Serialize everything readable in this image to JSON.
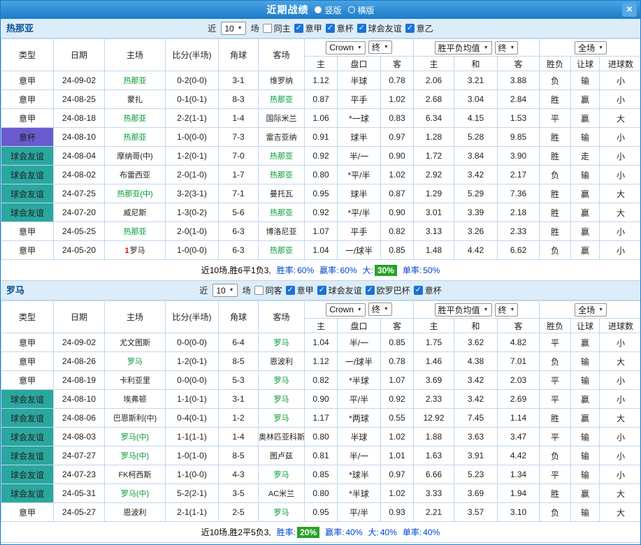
{
  "colors": {
    "accent_blue": "#1c7cc8",
    "section_bg": "#dcedf9",
    "table_border": "#bdd8ef",
    "win_red": "#e60000",
    "lose_green": "#009933",
    "odds_blue": "#0055cc",
    "coppa_purple": "#6a5bd0",
    "friendly_teal": "#2aa79e",
    "highlight_green": "#28a228"
  },
  "titlebar": {
    "title": "近期战绩",
    "layout_options": [
      {
        "label": "竖版",
        "selected": true
      },
      {
        "label": "横版",
        "selected": false
      }
    ],
    "close_label": "×"
  },
  "columns": {
    "type": "类型",
    "date": "日期",
    "home": "主场",
    "score": "比分(半场)",
    "corner": "角球",
    "away": "客场",
    "host": "主",
    "handicap": "盘口",
    "guest": "客",
    "avg_home": "主",
    "avg_draw": "和",
    "avg_away": "客",
    "result": "胜负",
    "handicap_result": "让球",
    "goals": "进球数"
  },
  "selectors": {
    "odds_source": "Crown",
    "odds_final": "终",
    "avg_method": "胜平负均值",
    "avg_final": "终",
    "scope": "全场"
  },
  "sections": [
    {
      "team": "热那亚",
      "filters": {
        "recent_label": "近",
        "count": "10",
        "unit_label": "场",
        "venue_filter": {
          "label": "同主",
          "checked": false
        },
        "competitions": [
          {
            "label": "意甲",
            "checked": true
          },
          {
            "label": "意杯",
            "checked": true
          },
          {
            "label": "球会友谊",
            "checked": true
          },
          {
            "label": "意乙",
            "checked": true
          }
        ]
      },
      "rows": [
        {
          "type": "意甲",
          "date": "24-09-02",
          "home": "热那亚",
          "rank": "",
          "score": "0-2(0-0)",
          "corners": "3-1",
          "away": "维罗纳",
          "odds_home": "1.12",
          "handicap": "半球",
          "odds_away": "0.78",
          "avg_home": "2.06",
          "avg_draw": "3.21",
          "avg_away": "3.88",
          "result": "负",
          "handicap_result": "输",
          "goals": "小"
        },
        {
          "type": "意甲",
          "date": "24-08-25",
          "home": "蒙扎",
          "rank": "",
          "score": "0-1(0-1)",
          "corners": "8-3",
          "away": "热那亚",
          "odds_home": "0.87",
          "handicap": "平手",
          "odds_away": "1.02",
          "avg_home": "2.68",
          "avg_draw": "3.04",
          "avg_away": "2.84",
          "result": "胜",
          "handicap_result": "赢",
          "goals": "小"
        },
        {
          "type": "意甲",
          "date": "24-08-18",
          "home": "热那亚",
          "rank": "",
          "score": "2-2(1-1)",
          "corners": "1-4",
          "away": "国际米兰",
          "odds_home": "1.06",
          "handicap": "*一球",
          "odds_away": "0.83",
          "avg_home": "6.34",
          "avg_draw": "4.15",
          "avg_away": "1.53",
          "result": "平",
          "handicap_result": "赢",
          "goals": "大"
        },
        {
          "type": "意杯",
          "date": "24-08-10",
          "home": "热那亚",
          "rank": "",
          "score": "1-0(0-0)",
          "corners": "7-3",
          "away": "雷吉亚纳",
          "odds_home": "0.91",
          "handicap": "球半",
          "odds_away": "0.97",
          "avg_home": "1.28",
          "avg_draw": "5.28",
          "avg_away": "9.85",
          "result": "胜",
          "handicap_result": "输",
          "goals": "小"
        },
        {
          "type": "球会友谊",
          "date": "24-08-04",
          "home": "摩纳哥(中)",
          "rank": "",
          "score": "1-2(0-1)",
          "corners": "7-0",
          "away": "热那亚",
          "odds_home": "0.92",
          "handicap": "半/一",
          "odds_away": "0.90",
          "avg_home": "1.72",
          "avg_draw": "3.84",
          "avg_away": "3.90",
          "result": "胜",
          "handicap_result": "走",
          "goals": "小"
        },
        {
          "type": "球会友谊",
          "date": "24-08-02",
          "home": "布雷西亚",
          "rank": "",
          "score": "2-0(1-0)",
          "corners": "1-7",
          "away": "热那亚",
          "odds_home": "0.80",
          "handicap": "*平/半",
          "odds_away": "1.02",
          "avg_home": "2.92",
          "avg_draw": "3.42",
          "avg_away": "2.17",
          "result": "负",
          "handicap_result": "输",
          "goals": "小"
        },
        {
          "type": "球会友谊",
          "date": "24-07-25",
          "home": "热那亚(中)",
          "rank": "",
          "score": "3-2(3-1)",
          "corners": "7-1",
          "away": "曼托瓦",
          "odds_home": "0.95",
          "handicap": "球半",
          "odds_away": "0.87",
          "avg_home": "1.29",
          "avg_draw": "5.29",
          "avg_away": "7.36",
          "result": "胜",
          "handicap_result": "赢",
          "goals": "大"
        },
        {
          "type": "球会友谊",
          "date": "24-07-20",
          "home": "威尼斯",
          "rank": "",
          "score": "1-3(0-2)",
          "corners": "5-6",
          "away": "热那亚",
          "odds_home": "0.92",
          "handicap": "*平/半",
          "odds_away": "0.90",
          "avg_home": "3.01",
          "avg_draw": "3.39",
          "avg_away": "2.18",
          "result": "胜",
          "handicap_result": "赢",
          "goals": "大"
        },
        {
          "type": "意甲",
          "date": "24-05-25",
          "home": "热那亚",
          "rank": "",
          "score": "2-0(1-0)",
          "corners": "6-3",
          "away": "博洛尼亚",
          "odds_home": "1.07",
          "handicap": "平手",
          "odds_away": "0.82",
          "avg_home": "3.13",
          "avg_draw": "3.26",
          "avg_away": "2.33",
          "result": "胜",
          "handicap_result": "赢",
          "goals": "小"
        },
        {
          "type": "意甲",
          "date": "24-05-20",
          "home": "罗马",
          "rank": "1",
          "score": "1-0(0-0)",
          "corners": "6-3",
          "away": "热那亚",
          "odds_home": "1.04",
          "handicap": "一/球半",
          "odds_away": "0.85",
          "avg_home": "1.48",
          "avg_draw": "4.42",
          "avg_away": "6.62",
          "result": "负",
          "handicap_result": "赢",
          "goals": "小"
        }
      ],
      "footer": {
        "summary": "近10场,胜6平1负3,",
        "stats": [
          {
            "label": "胜率:",
            "value": "60%",
            "highlight": false
          },
          {
            "label": "赢率:",
            "value": "60%",
            "highlight": false
          },
          {
            "label": "大:",
            "value": "30%",
            "highlight": true
          },
          {
            "label": "单率:",
            "value": "50%",
            "highlight": false
          }
        ]
      }
    },
    {
      "team": "罗马",
      "filters": {
        "recent_label": "近",
        "count": "10",
        "unit_label": "场",
        "venue_filter": {
          "label": "同客",
          "checked": false
        },
        "competitions": [
          {
            "label": "意甲",
            "checked": true
          },
          {
            "label": "球会友谊",
            "checked": true
          },
          {
            "label": "欧罗巴杯",
            "checked": true
          },
          {
            "label": "意杯",
            "checked": true
          }
        ]
      },
      "rows": [
        {
          "type": "意甲",
          "date": "24-09-02",
          "home": "尤文图斯",
          "rank": "",
          "score": "0-0(0-0)",
          "corners": "6-4",
          "away": "罗马",
          "odds_home": "1.04",
          "handicap": "半/一",
          "odds_away": "0.85",
          "avg_home": "1.75",
          "avg_draw": "3.62",
          "avg_away": "4.82",
          "result": "平",
          "handicap_result": "赢",
          "goals": "小"
        },
        {
          "type": "意甲",
          "date": "24-08-26",
          "home": "罗马",
          "rank": "",
          "score": "1-2(0-1)",
          "corners": "8-5",
          "away": "恩波利",
          "odds_home": "1.12",
          "handicap": "一/球半",
          "odds_away": "0.78",
          "avg_home": "1.46",
          "avg_draw": "4.38",
          "avg_away": "7.01",
          "result": "负",
          "handicap_result": "输",
          "goals": "大"
        },
        {
          "type": "意甲",
          "date": "24-08-19",
          "home": "卡利亚里",
          "rank": "",
          "score": "0-0(0-0)",
          "corners": "5-3",
          "away": "罗马",
          "odds_home": "0.82",
          "handicap": "*半球",
          "odds_away": "1.07",
          "avg_home": "3.69",
          "avg_draw": "3.42",
          "avg_away": "2.03",
          "result": "平",
          "handicap_result": "输",
          "goals": "小"
        },
        {
          "type": "球会友谊",
          "date": "24-08-10",
          "home": "埃弗顿",
          "rank": "",
          "score": "1-1(0-1)",
          "corners": "3-1",
          "away": "罗马",
          "odds_home": "0.90",
          "handicap": "平/半",
          "odds_away": "0.92",
          "avg_home": "2.33",
          "avg_draw": "3.42",
          "avg_away": "2.69",
          "result": "平",
          "handicap_result": "赢",
          "goals": "小"
        },
        {
          "type": "球会友谊",
          "date": "24-08-06",
          "home": "巴恩斯利(中)",
          "rank": "",
          "score": "0-4(0-1)",
          "corners": "1-2",
          "away": "罗马",
          "odds_home": "1.17",
          "handicap": "*两球",
          "odds_away": "0.55",
          "avg_home": "12.92",
          "avg_draw": "7.45",
          "avg_away": "1.14",
          "result": "胜",
          "handicap_result": "赢",
          "goals": "大"
        },
        {
          "type": "球会友谊",
          "date": "24-08-03",
          "home": "罗马(中)",
          "rank": "",
          "score": "1-1(1-1)",
          "corners": "1-4",
          "away": "奥林匹亚科斯",
          "odds_home": "0.80",
          "handicap": "半球",
          "odds_away": "1.02",
          "avg_home": "1.88",
          "avg_draw": "3.63",
          "avg_away": "3.47",
          "result": "平",
          "handicap_result": "输",
          "goals": "小"
        },
        {
          "type": "球会友谊",
          "date": "24-07-27",
          "home": "罗马(中)",
          "rank": "",
          "score": "1-0(1-0)",
          "corners": "8-5",
          "away": "图卢兹",
          "odds_home": "0.81",
          "handicap": "半/一",
          "odds_away": "1.01",
          "avg_home": "1.63",
          "avg_draw": "3.91",
          "avg_away": "4.42",
          "result": "负",
          "handicap_result": "输",
          "goals": "小"
        },
        {
          "type": "球会友谊",
          "date": "24-07-23",
          "home": "FK柯西斯",
          "rank": "",
          "score": "1-1(0-0)",
          "corners": "4-3",
          "away": "罗马",
          "odds_home": "0.85",
          "handicap": "*球半",
          "odds_away": "0.97",
          "avg_home": "6.66",
          "avg_draw": "5.23",
          "avg_away": "1.34",
          "result": "平",
          "handicap_result": "输",
          "goals": "小"
        },
        {
          "type": "球会友谊",
          "date": "24-05-31",
          "home": "罗马(中)",
          "rank": "",
          "score": "5-2(2-1)",
          "corners": "3-5",
          "away": "AC米兰",
          "odds_home": "0.80",
          "handicap": "*半球",
          "odds_away": "1.02",
          "avg_home": "3.33",
          "avg_draw": "3.69",
          "avg_away": "1.94",
          "result": "胜",
          "handicap_result": "赢",
          "goals": "大"
        },
        {
          "type": "意甲",
          "date": "24-05-27",
          "home": "恩波利",
          "rank": "",
          "score": "2-1(1-1)",
          "corners": "2-5",
          "away": "罗马",
          "odds_home": "0.95",
          "handicap": "平/半",
          "odds_away": "0.93",
          "avg_home": "2.21",
          "avg_draw": "3.57",
          "avg_away": "3.10",
          "result": "负",
          "handicap_result": "输",
          "goals": "大"
        }
      ],
      "footer": {
        "summary": "近10场,胜2平5负3,",
        "stats": [
          {
            "label": "胜率:",
            "value": "20%",
            "highlight": true
          },
          {
            "label": "赢率:",
            "value": "40%",
            "highlight": false
          },
          {
            "label": "大:",
            "value": "40%",
            "highlight": false
          },
          {
            "label": "单率:",
            "value": "40%",
            "highlight": false
          }
        ]
      }
    }
  ]
}
